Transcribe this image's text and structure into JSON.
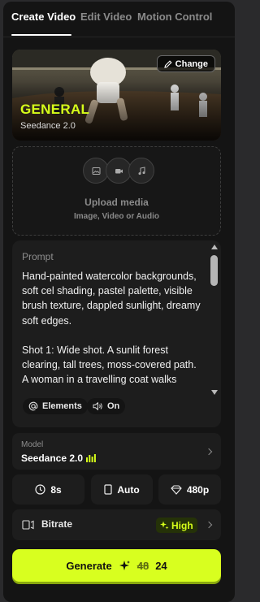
{
  "tabs": [
    {
      "label": "Create Video",
      "active": true
    },
    {
      "label": "Edit Video",
      "active": false
    },
    {
      "label": "Motion Control",
      "active": false
    }
  ],
  "hero": {
    "change_label": "Change",
    "title": "GENERAL",
    "subtitle": "Seedance 2.0"
  },
  "upload": {
    "title": "Upload media",
    "subtitle": "Image, Video or Audio",
    "icons": [
      "image-icon",
      "video-icon",
      "music-icon"
    ]
  },
  "prompt": {
    "label": "Prompt",
    "text": "Hand-painted watercolor backgrounds, soft cel shading, pastel palette, visible brush texture, dappled sunlight, dreamy soft edges.\n\nShot 1: Wide shot. A sunlit forest clearing, tall trees, moss-covered path. A woman in a travelling coat walks slowly into frame, boots pressing",
    "elements_label": "Elements",
    "audio_label": "On"
  },
  "model": {
    "label": "Model",
    "name": "Seedance 2.0"
  },
  "options": {
    "duration": "8s",
    "aspect": "Auto",
    "resolution": "480p"
  },
  "bitrate": {
    "label": "Bitrate",
    "value": "High"
  },
  "generate": {
    "label": "Generate",
    "old_cost": "48",
    "cost": "24"
  },
  "colors": {
    "accent": "#d8ff1f",
    "panel": "#141414",
    "card": "#1d1d1d"
  }
}
